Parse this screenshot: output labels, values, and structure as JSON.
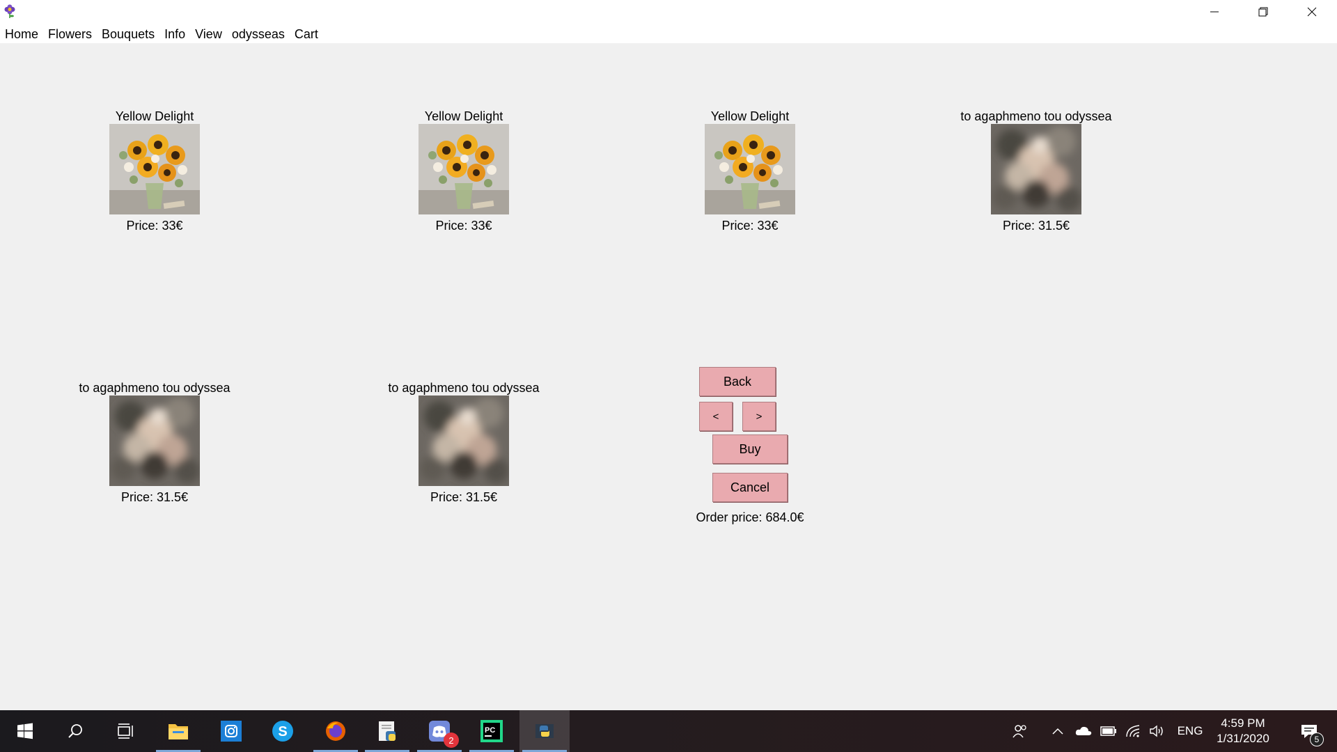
{
  "menu": [
    "Home",
    "Flowers",
    "Bouquets",
    "Info",
    "View",
    "odysseas",
    "Cart"
  ],
  "cart_items": [
    {
      "name": "Yellow Delight",
      "price": "Price: 33€",
      "image": "sunflower-bouquet"
    },
    {
      "name": "Yellow Delight",
      "price": "Price: 33€",
      "image": "sunflower-bouquet"
    },
    {
      "name": "Yellow Delight",
      "price": "Price: 33€",
      "image": "sunflower-bouquet"
    },
    {
      "name": "to agaphmeno tou odyssea",
      "price": "Price: 31.5€",
      "image": "blurred-bouquet"
    },
    {
      "name": "to agaphmeno tou odyssea",
      "price": "Price: 31.5€",
      "image": "blurred-bouquet"
    },
    {
      "name": "to agaphmeno tou odyssea",
      "price": "Price: 31.5€",
      "image": "blurred-bouquet"
    }
  ],
  "controls": {
    "back": "Back",
    "prev": "<",
    "next": ">",
    "buy": "Buy",
    "cancel": "Cancel",
    "order_price": "Order price: 684.0€",
    "button_color": "#e9aaaf"
  },
  "taskbar": {
    "apps": [
      "windows-start",
      "search",
      "task-view",
      "file-explorer",
      "instagram",
      "skype",
      "firefox",
      "notepad-python",
      "discord",
      "pycharm",
      "python"
    ],
    "discord_badge": "2",
    "lang": "ENG",
    "time": "4:59 PM",
    "date": "1/31/2020",
    "notification_count": "5"
  }
}
